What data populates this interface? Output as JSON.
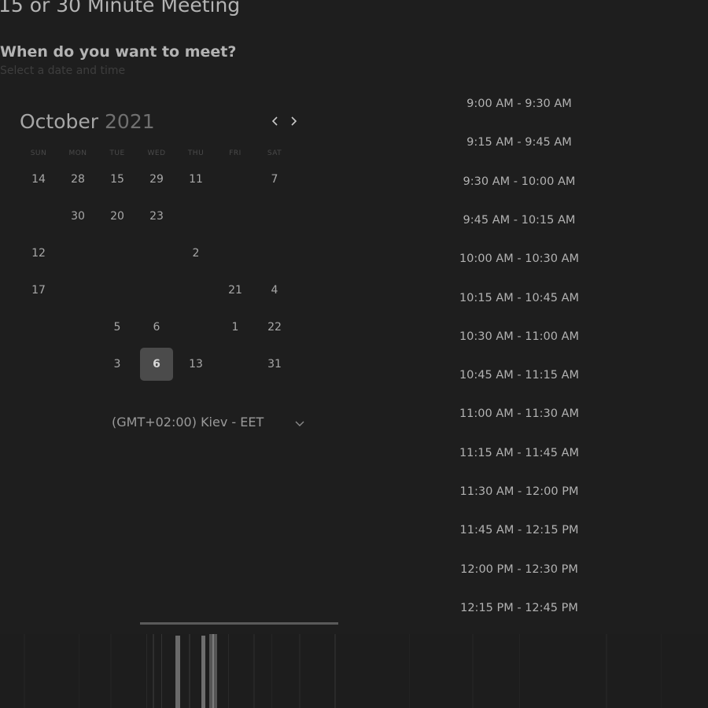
{
  "header": {
    "title": "15 or 30 Minute Meeting",
    "question": "When do you want to meet?",
    "subtitle": "Select a date and time"
  },
  "calendar": {
    "month": "October",
    "year": "2021",
    "prev_icon": "chevron-left-icon",
    "next_icon": "chevron-right-icon",
    "weekdays": [
      "SUN",
      "MON",
      "TUE",
      "WED",
      "THU",
      "FRI",
      "SAT"
    ],
    "weeks": [
      [
        {
          "label": "14"
        },
        {
          "label": "28"
        },
        {
          "label": "15"
        },
        {
          "label": "29"
        },
        {
          "label": "11"
        },
        {
          "label": "",
          "dim": true
        },
        {
          "label": "7"
        }
      ],
      [
        {
          "label": "",
          "dim": true
        },
        {
          "label": "30"
        },
        {
          "label": "20"
        },
        {
          "label": "23"
        },
        {
          "label": "",
          "dim": true
        },
        {
          "label": "",
          "dim": true
        },
        {
          "label": "",
          "dim": true
        }
      ],
      [
        {
          "label": "12"
        },
        {
          "label": "",
          "dim": true
        },
        {
          "label": "",
          "dim": true
        },
        {
          "label": "",
          "dim": true
        },
        {
          "label": "2"
        },
        {
          "label": "",
          "dim": true
        },
        {
          "label": "",
          "dim": true
        }
      ],
      [
        {
          "label": "17"
        },
        {
          "label": "",
          "dim": true
        },
        {
          "label": "",
          "dim": true
        },
        {
          "label": "",
          "dim": true
        },
        {
          "label": "",
          "dim": true
        },
        {
          "label": "21"
        },
        {
          "label": "4"
        }
      ],
      [
        {
          "label": "",
          "dim": true
        },
        {
          "label": "",
          "dim": true
        },
        {
          "label": "5"
        },
        {
          "label": "6"
        },
        {
          "label": "",
          "dim": true
        },
        {
          "label": "1"
        },
        {
          "label": "22"
        }
      ],
      [
        {
          "label": "",
          "dim": true
        },
        {
          "label": "",
          "dim": true
        },
        {
          "label": "3"
        },
        {
          "label": "6",
          "selected": true
        },
        {
          "label": "13"
        },
        {
          "label": "",
          "dim": true
        },
        {
          "label": "31"
        }
      ]
    ]
  },
  "timezone": {
    "label": "(GMT+02:00) Kiev - EET",
    "icon": "chevron-down-icon"
  },
  "time_slots": [
    "9:00 AM - 9:30 AM",
    "9:15 AM - 9:45 AM",
    "9:30 AM - 10:00 AM",
    "9:45 AM - 10:15 AM",
    "10:00 AM - 10:30 AM",
    "10:15 AM - 10:45 AM",
    "10:30 AM - 11:00 AM",
    "10:45 AM - 11:15 AM",
    "11:00 AM - 11:30 AM",
    "11:15 AM - 11:45 AM",
    "11:30 AM - 12:00 PM",
    "11:45 AM - 12:15 PM",
    "12:00 PM - 12:30 PM",
    "12:15 PM - 12:45 PM"
  ],
  "colors": {
    "background": "#1e1e1e",
    "selected_day": "#4b4b4b",
    "text": "#b2b2b2"
  }
}
